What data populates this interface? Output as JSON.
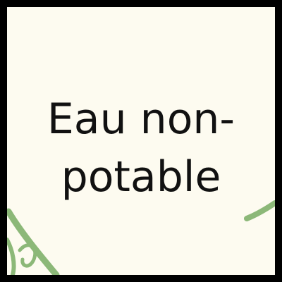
{
  "sign": {
    "line1": "Eau non-",
    "line2": "potable"
  },
  "colors": {
    "frame": "#000000",
    "panel": "#fdfbf0",
    "text": "#111111",
    "vine": "#8cb878"
  }
}
